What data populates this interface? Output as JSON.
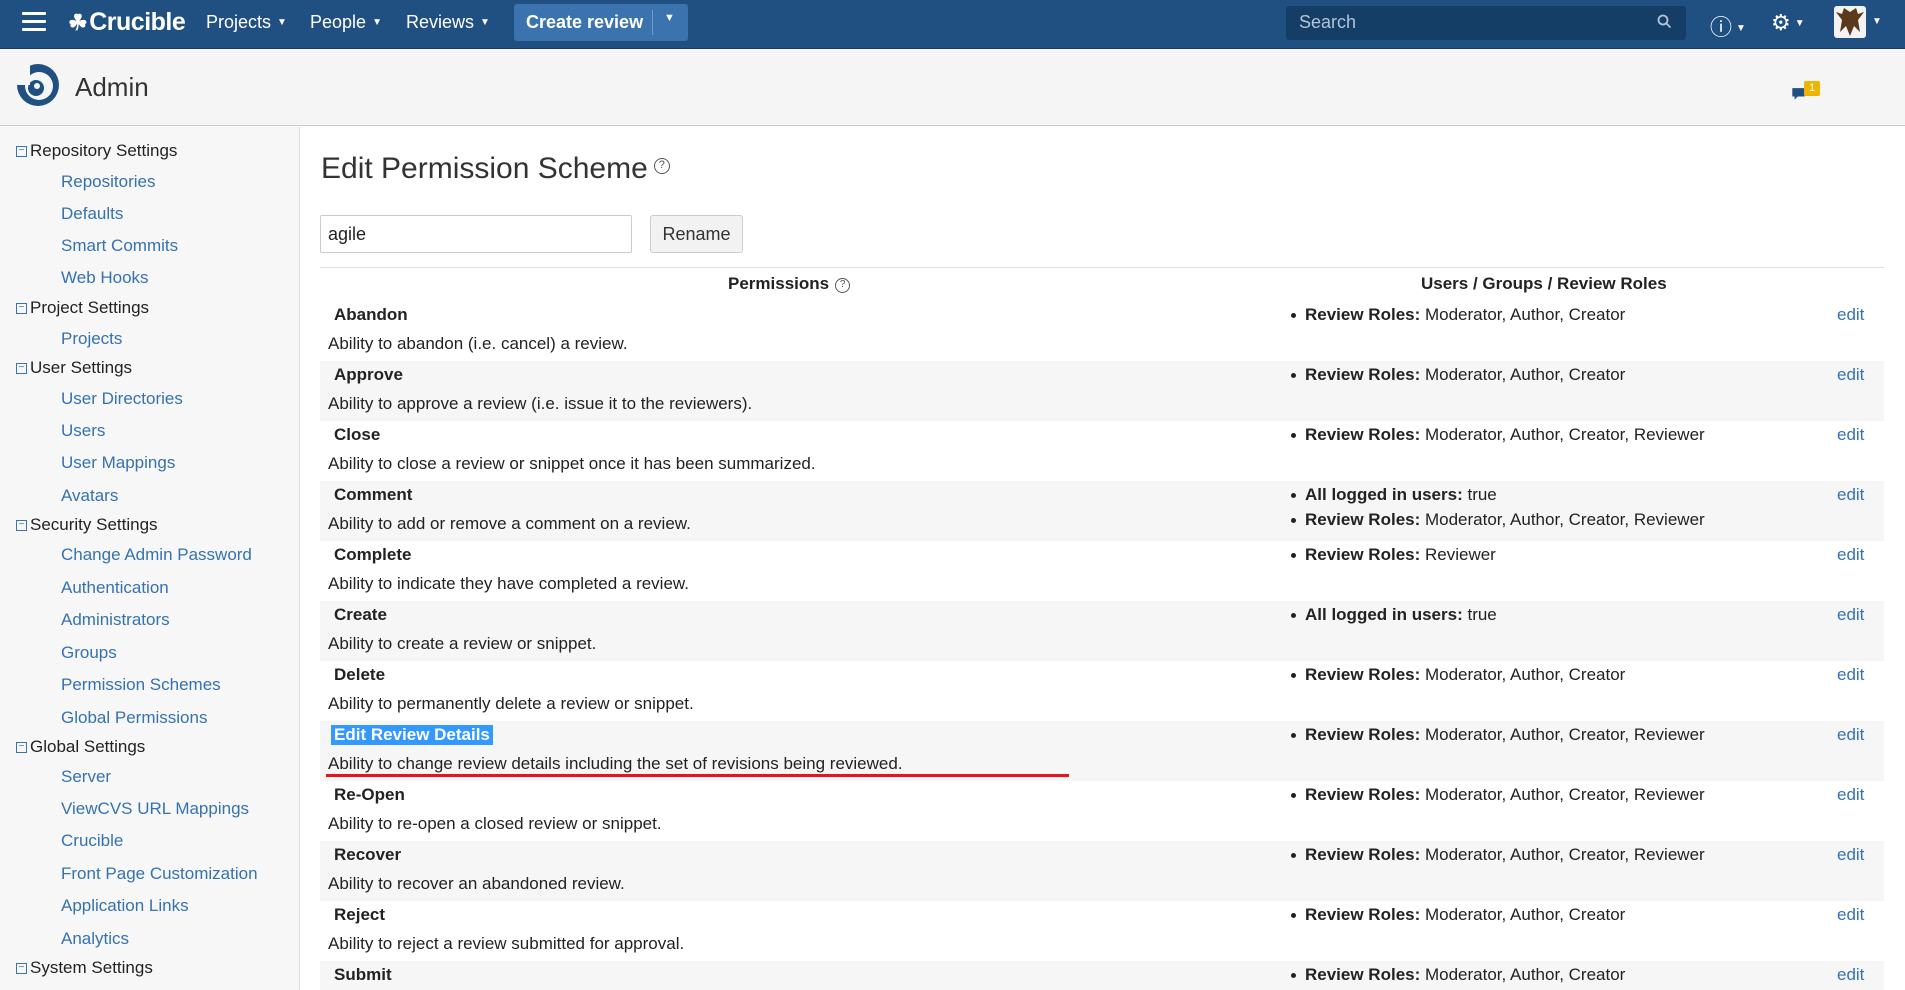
{
  "topbar": {
    "logo_text": "Crucible",
    "nav": [
      "Projects",
      "People",
      "Reviews"
    ],
    "create_review": "Create review",
    "search_placeholder": "Search",
    "icons": [
      "hamburger-icon",
      "help-icon",
      "gear-icon",
      "avatar"
    ]
  },
  "header": {
    "title": "Admin",
    "notification_count": "1"
  },
  "sidebar": {
    "sections": [
      {
        "label": "Repository Settings",
        "items": [
          "Repositories",
          "Defaults",
          "Smart Commits",
          "Web Hooks"
        ]
      },
      {
        "label": "Project Settings",
        "items": [
          "Projects"
        ]
      },
      {
        "label": "User Settings",
        "items": [
          "User Directories",
          "Users",
          "User Mappings",
          "Avatars"
        ]
      },
      {
        "label": "Security Settings",
        "items": [
          "Change Admin Password",
          "Authentication",
          "Administrators",
          "Groups",
          "Permission Schemes",
          "Global Permissions"
        ]
      },
      {
        "label": "Global Settings",
        "items": [
          "Server",
          "ViewCVS URL Mappings",
          "Crucible",
          "Front Page Customization",
          "Application Links",
          "Analytics"
        ]
      },
      {
        "label": "System Settings",
        "items": []
      }
    ]
  },
  "main": {
    "title": "Edit Permission Scheme",
    "scheme_name": "agile",
    "rename_label": "Rename",
    "col_permissions": "Permissions",
    "col_users": "Users / Groups / Review Roles",
    "edit_label": "edit",
    "rows": [
      {
        "name": "Abandon",
        "desc": "Ability to abandon (i.e. cancel) a review.",
        "roles": [
          {
            "k": "Review Roles:",
            "v": " Moderator, Author, Creator"
          }
        ]
      },
      {
        "name": "Approve",
        "desc": "Ability to approve a review (i.e. issue it to the reviewers).",
        "roles": [
          {
            "k": "Review Roles:",
            "v": " Moderator, Author, Creator"
          }
        ]
      },
      {
        "name": "Close",
        "desc": "Ability to close a review or snippet once it has been summarized.",
        "roles": [
          {
            "k": "Review Roles:",
            "v": " Moderator, Author, Creator, Reviewer"
          }
        ]
      },
      {
        "name": "Comment",
        "desc": "Ability to add or remove a comment on a review.",
        "roles": [
          {
            "k": "All logged in users:",
            "v": " true"
          },
          {
            "k": "Review Roles:",
            "v": " Moderator, Author, Creator, Reviewer"
          }
        ]
      },
      {
        "name": "Complete",
        "desc": "Ability to indicate they have completed a review.",
        "roles": [
          {
            "k": "Review Roles:",
            "v": " Reviewer"
          }
        ]
      },
      {
        "name": "Create",
        "desc": "Ability to create a review or snippet.",
        "roles": [
          {
            "k": "All logged in users:",
            "v": " true"
          }
        ]
      },
      {
        "name": "Delete",
        "desc": "Ability to permanently delete a review or snippet.",
        "roles": [
          {
            "k": "Review Roles:",
            "v": " Moderator, Author, Creator"
          }
        ]
      },
      {
        "name": "Edit Review Details",
        "desc": "Ability to change review details including the set of revisions being reviewed.",
        "roles": [
          {
            "k": "Review Roles:",
            "v": " Moderator, Author, Creator, Reviewer"
          }
        ]
      },
      {
        "name": "Re-Open",
        "desc": "Ability to re-open a closed review or snippet.",
        "roles": [
          {
            "k": "Review Roles:",
            "v": " Moderator, Author, Creator, Reviewer"
          }
        ]
      },
      {
        "name": "Recover",
        "desc": "Ability to recover an abandoned review.",
        "roles": [
          {
            "k": "Review Roles:",
            "v": " Moderator, Author, Creator, Reviewer"
          }
        ]
      },
      {
        "name": "Reject",
        "desc": "Ability to reject a review submitted for approval.",
        "roles": [
          {
            "k": "Review Roles:",
            "v": " Moderator, Author, Creator"
          }
        ]
      },
      {
        "name": "Submit",
        "desc": "",
        "roles": [
          {
            "k": "Review Roles:",
            "v": " Moderator, Author, Creator"
          }
        ]
      }
    ]
  }
}
